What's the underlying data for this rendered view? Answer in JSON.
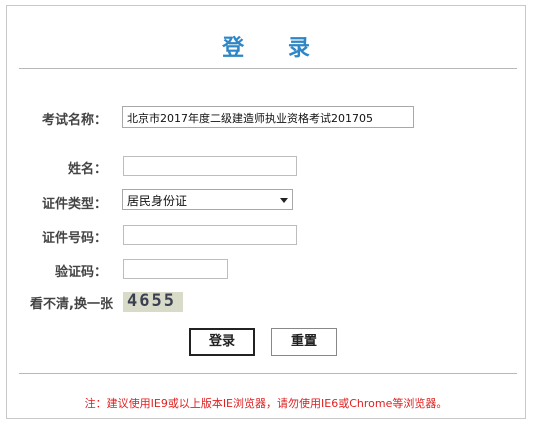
{
  "title": "登  录",
  "form": {
    "exam_label": "考试名称：",
    "exam_value": "北京市2017年度二级建造师执业资格考试201705",
    "name_label": "姓名：",
    "name_value": "",
    "id_type_label": "证件类型：",
    "id_type_value": "居民身份证",
    "id_number_label": "证件号码：",
    "id_number_value": "",
    "captcha_label": "验证码：",
    "captcha_value": "",
    "refresh_label": "看不清,换一张",
    "captcha_text": "4655"
  },
  "buttons": {
    "login": "登录",
    "reset": "重置"
  },
  "note": "注：建议使用IE9或以上版本IE浏览器，请勿使用IE6或Chrome等浏览器。"
}
